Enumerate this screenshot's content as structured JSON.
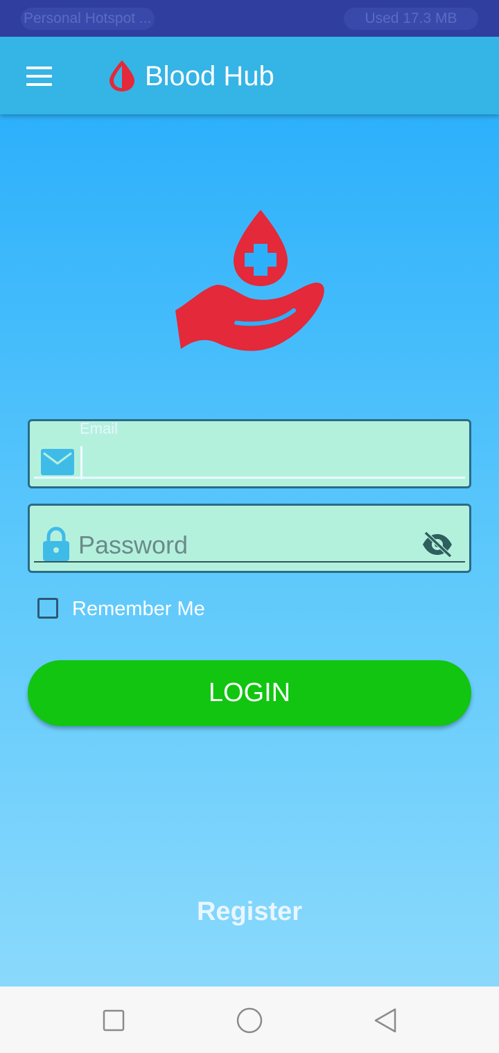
{
  "status_bar": {
    "hotspot_label": "Personal Hotspot ...",
    "data_usage": "Used  17.3 MB"
  },
  "app_bar": {
    "menu_icon": "hamburger-menu-icon",
    "logo_icon": "blood-drop-icon",
    "title": "Blood Hub"
  },
  "hero": {
    "icon": "hand-holding-blood-drop-icon"
  },
  "email_field": {
    "label": "Email",
    "value": "",
    "icon": "mail-icon"
  },
  "password_field": {
    "placeholder": "Password",
    "value": "",
    "icon": "lock-icon",
    "toggle_icon": "eye-off-icon"
  },
  "remember_me": {
    "label": "Remember Me",
    "checked": false
  },
  "login_button": {
    "label": "LOGIN"
  },
  "register_link": {
    "label": "Register"
  },
  "nav_bar": {
    "recent_icon": "square-recent-icon",
    "home_icon": "circle-home-icon",
    "back_icon": "triangle-back-icon"
  },
  "colors": {
    "app_bar": "#35b4e6",
    "status_bar": "#303f9f",
    "field_bg": "#b4f1dd",
    "login_button": "#11c511",
    "brand_red": "#e3293a"
  }
}
